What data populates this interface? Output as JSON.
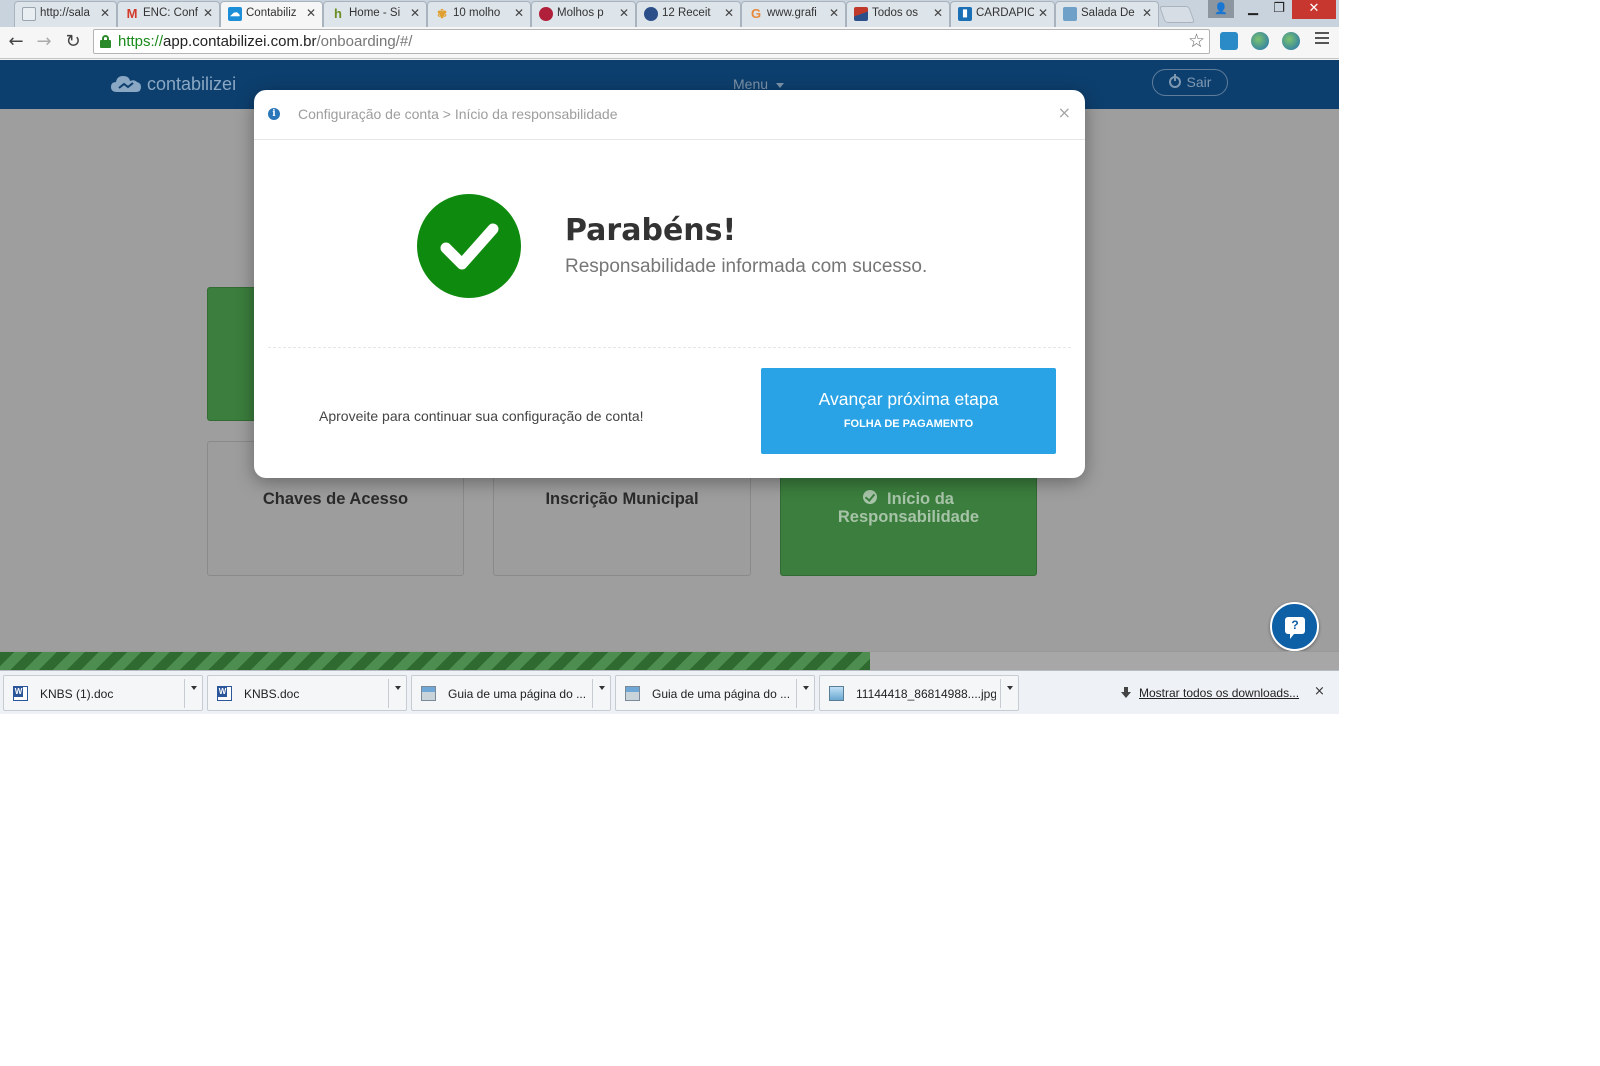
{
  "browser": {
    "tabs": [
      {
        "title": "http://sala",
        "favicon": "page-icon",
        "color": "#9aa4ae"
      },
      {
        "title": "ENC: Conf",
        "favicon": "gmail-icon",
        "color": "#d33a2c"
      },
      {
        "title": "Contabiliz",
        "favicon": "contabilizei-icon",
        "color": "#1d8fd8",
        "active": true
      },
      {
        "title": "Home - Si",
        "favicon": "site-icon",
        "color": "#6b8e23"
      },
      {
        "title": "10 molho",
        "favicon": "pinwheel-icon",
        "color": "#e0a030"
      },
      {
        "title": "Molhos p",
        "favicon": "food-icon",
        "color": "#b0203a"
      },
      {
        "title": "12 Receit",
        "favicon": "globe-icon",
        "color": "#2c4f8a"
      },
      {
        "title": "www.grafi",
        "favicon": "google-icon",
        "color": "#e8883a"
      },
      {
        "title": "Todos os",
        "favicon": "flag-icon",
        "color": "#c0392b"
      },
      {
        "title": "CARDAPIO",
        "favicon": "trello-icon",
        "color": "#1a6fb5"
      },
      {
        "title": "Salada De",
        "favicon": "image-icon",
        "color": "#6fa0c8"
      }
    ],
    "url": {
      "scheme": "https://",
      "host": "app.contabilizei.com.br",
      "path": "/onboarding/#/"
    }
  },
  "app": {
    "logo_text": "contabilizei",
    "menu_label": "Menu",
    "logout_label": "Sair",
    "cards": [
      {
        "label": "Chaves de Acesso"
      },
      {
        "label": "Inscrição Municipal"
      },
      {
        "label_line1": "Início da",
        "label_line2": "Responsabilidade"
      }
    ],
    "progress": 0.65
  },
  "modal": {
    "breadcrumb": "Configuração de conta > Início da responsabilidade",
    "close_symbol": "×",
    "title": "Parabéns!",
    "message": "Responsabilidade informada com sucesso.",
    "footer_text": "Aproveite para continuar sua configuração de conta!",
    "next_button": {
      "label": "Avançar próxima etapa",
      "sublabel": "FOLHA DE PAGAMENTO"
    }
  },
  "downloads": {
    "items": [
      {
        "name": "KNBS (1).doc",
        "icon": "word-icon"
      },
      {
        "name": "KNBS.doc",
        "icon": "word-icon"
      },
      {
        "name": "Guia de uma página do ...",
        "icon": "scanner-icon"
      },
      {
        "name": "Guia de uma página do ...",
        "icon": "scanner-icon"
      },
      {
        "name": "11144418_86814988....jpg",
        "icon": "image-icon"
      }
    ],
    "show_all_label": "Mostrar todos os downloads...",
    "close_symbol": "×"
  },
  "colors": {
    "header_bg": "#0d3f6e",
    "success_green": "#0e8a0e",
    "button_blue": "#29a3e5",
    "card_green": "#3b7e3d"
  }
}
